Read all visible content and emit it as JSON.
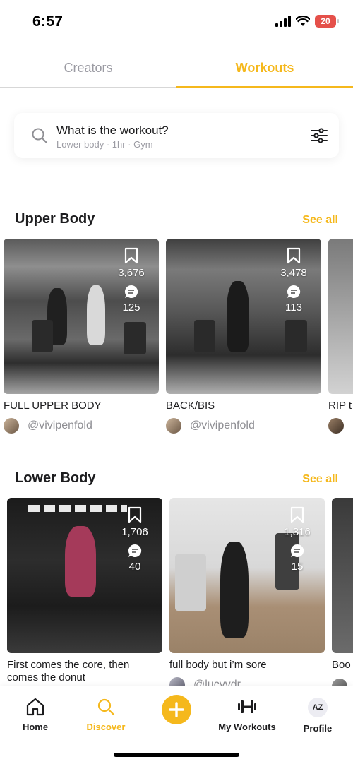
{
  "status_bar": {
    "time": "6:57",
    "battery": "20"
  },
  "tabs": [
    {
      "label": "Creators",
      "active": false
    },
    {
      "label": "Workouts",
      "active": true
    }
  ],
  "search": {
    "title": "What is the workout?",
    "subtitle": "Lower body · 1hr · Gym"
  },
  "sections": [
    {
      "title": "Upper Body",
      "see_all": "See all",
      "cards": [
        {
          "title": "FULL UPPER BODY",
          "user": "@vivipenfold",
          "saves": "3,676",
          "comments": "125"
        },
        {
          "title": "BACK/BIS",
          "user": "@vivipenfold",
          "saves": "3,478",
          "comments": "113"
        },
        {
          "title": "RIP t",
          "user": ""
        }
      ]
    },
    {
      "title": "Lower Body",
      "see_all": "See all",
      "cards": [
        {
          "title": "First comes the core, then comes the donut",
          "user": "",
          "saves": "1,706",
          "comments": "40"
        },
        {
          "title": "full body but i’m sore",
          "user": "@lucyvdr",
          "saves": "1,316",
          "comments": "15"
        },
        {
          "title": "Boo",
          "user": ""
        }
      ]
    }
  ],
  "bottom_nav": [
    {
      "label": "Home",
      "icon": "home-icon"
    },
    {
      "label": "Discover",
      "icon": "search-icon",
      "active": true
    },
    {
      "label": "",
      "icon": "plus-icon"
    },
    {
      "label": "My Workouts",
      "icon": "dumbbell-icon"
    },
    {
      "label": "Profile",
      "icon": "profile-avatar",
      "initials": "AZ"
    }
  ],
  "colors": {
    "accent": "#f5b81c",
    "muted": "#9b9ba3",
    "text": "#1c1c1e",
    "battery": "#e5504a"
  }
}
